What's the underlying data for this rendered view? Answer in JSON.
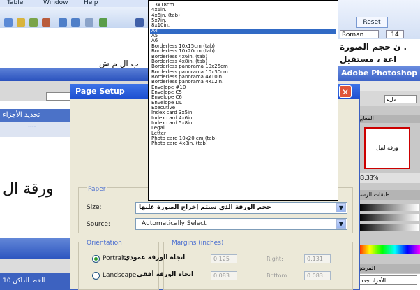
{
  "word": {
    "menu": [
      "Table",
      "Window",
      "Help"
    ],
    "doc_text": "ب ال م ش",
    "tab_label": "تحديد الأجزاء",
    "tab_link": "----",
    "big_arabic": "ورقة ال",
    "bottom_tab": "الخط الداكن 10"
  },
  "right_panel": {
    "reset_label": "Reset",
    "font_name": "Roman",
    "font_size": "14",
    "arabic_line1": "ن حجم الصورة .",
    "arabic_line2": "اعة ، مستقيل",
    "photoshop_title": "Adobe Photoshop",
    "ps_field": "ملء",
    "nav_tabs": "المعاين",
    "nav_image_text": "ورقة لنيل",
    "zoom_text": "33.33%",
    "layers_tab": "طبقات الرسم",
    "bottom_tab": "المرشح",
    "bottom_field": "الأفراد جدد"
  },
  "dialog": {
    "title": "Page Setup",
    "close_glyph": "✕",
    "paper_group_label": "Paper",
    "size_label": "Size:",
    "size_value": "حجم الورقة الذي سيتم إخراج الصورة عليها",
    "source_label": "Source:",
    "source_value": "Automatically Select",
    "orientation_label": "Orientation",
    "portrait_label": "Portrait",
    "portrait_annotation": "اتجاه الورقة عمودي",
    "landscape_label": "Landscape",
    "landscape_annotation": "اتجاه الورقة أفقي",
    "margins_label": "Margins (inches)",
    "margin_left_value": "0.125",
    "margin_right_label": "Right:",
    "margin_right_value": "0.131",
    "margin_top_value": "0.083",
    "margin_bottom_label": "Bottom:",
    "margin_bottom_value": "0.083",
    "selected_index": 5
  },
  "dropdown_items": [
    "13x18cm",
    "4x6in.",
    "4x6in. (tab)",
    "5x7in.",
    "8x10in.",
    "A4",
    "A5",
    "A6",
    "Borderless 10x15cm (tab)",
    "Borderless 10x20cm (tab)",
    "Borderless 4x6in. (tab)",
    "Borderless 4x8in. (tab)",
    "Borderless panorama 10x25cm",
    "Borderless panorama 10x30cm",
    "Borderless panorama 4x10in.",
    "Borderless panorama 4x12in.",
    "Envelope #10",
    "Envelope C5",
    "Envelope C6",
    "Envelope DL",
    "Executive",
    "Index card 3x5in.",
    "Index card 4x6in.",
    "Index card 5x8in.",
    "Legal",
    "Letter",
    "Photo card 10x20 cm (tab)",
    "Photo card 4x8in. (tab)"
  ],
  "colors": {
    "selection": "#316ac5",
    "dialog_bg": "#ece9d8",
    "titlebar": "#1d4fd0",
    "annotation_text": "#111111"
  }
}
